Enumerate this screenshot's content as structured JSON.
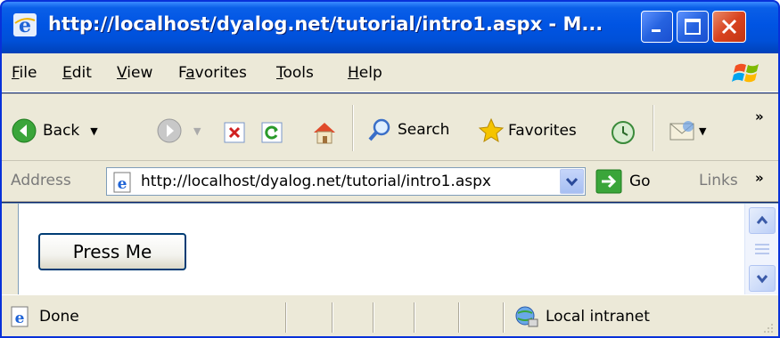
{
  "window": {
    "title": "http://localhost/dyalog.net/tutorial/intro1.aspx - M..."
  },
  "menu": {
    "items": [
      {
        "label": "File",
        "underline": "F",
        "rest": "ile"
      },
      {
        "label": "Edit",
        "underline": "E",
        "rest": "dit"
      },
      {
        "label": "View",
        "underline": "V",
        "rest": "iew"
      },
      {
        "label": "Favorites",
        "pre": "F",
        "underline": "a",
        "rest": "vorites"
      },
      {
        "label": "Tools",
        "underline": "T",
        "rest": "ools"
      },
      {
        "label": "Help",
        "underline": "H",
        "rest": "elp"
      }
    ]
  },
  "toolbar": {
    "back_label": "Back",
    "search_label": "Search",
    "favorites_label": "Favorites",
    "overflow": "»"
  },
  "address": {
    "label": "Address",
    "url": "http://localhost/dyalog.net/tutorial/intro1.aspx",
    "go_label": "Go",
    "links_label": "Links",
    "links_overflow": "»"
  },
  "content": {
    "button_label": "Press Me"
  },
  "status": {
    "text": "Done",
    "zone": "Local intranet"
  },
  "colors": {
    "titlebar": "#0054e3",
    "chrome": "#ece9d8",
    "close": "#d8431f"
  }
}
